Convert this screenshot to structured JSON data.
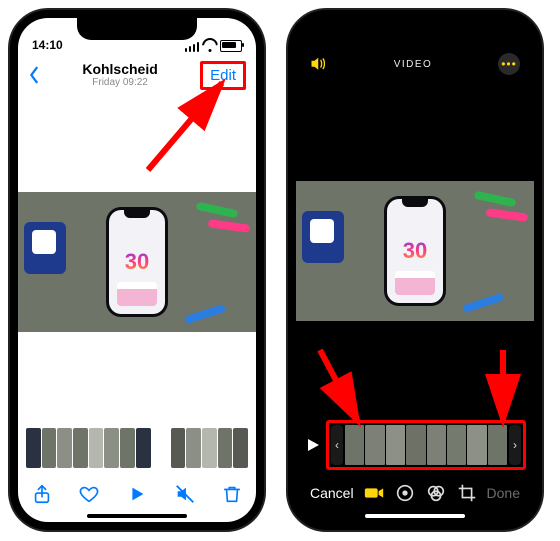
{
  "viewer": {
    "status_time": "14:10",
    "location": "Kohlscheid",
    "subtitle": "Friday  09:22",
    "back_icon": "chevron-left-icon",
    "edit_label": "Edit",
    "video_badge": "30",
    "toolbar": {
      "share_icon": "share-icon",
      "favorite_icon": "heart-icon",
      "play_icon": "play-icon",
      "mute_icon": "mute-icon",
      "trash_icon": "trash-icon"
    }
  },
  "editor": {
    "speaker_icon": "speaker-icon",
    "mode_label": "VIDEO",
    "more_icon": "more-icon",
    "video_badge": "30",
    "trim": {
      "play_icon": "play-mini-icon",
      "left_handle_icon": "trim-left-handle",
      "right_handle_icon": "trim-right-handle"
    },
    "cancel_label": "Cancel",
    "done_label": "Done",
    "tools": {
      "video_icon": "video-tool-icon",
      "adjust_icon": "adjust-tool-icon",
      "filters_icon": "filters-tool-icon",
      "crop_icon": "crop-tool-icon"
    }
  },
  "colors": {
    "ios_blue": "#007aff",
    "ios_yellow": "#ffd60a",
    "annotation_red": "#ff0000"
  }
}
